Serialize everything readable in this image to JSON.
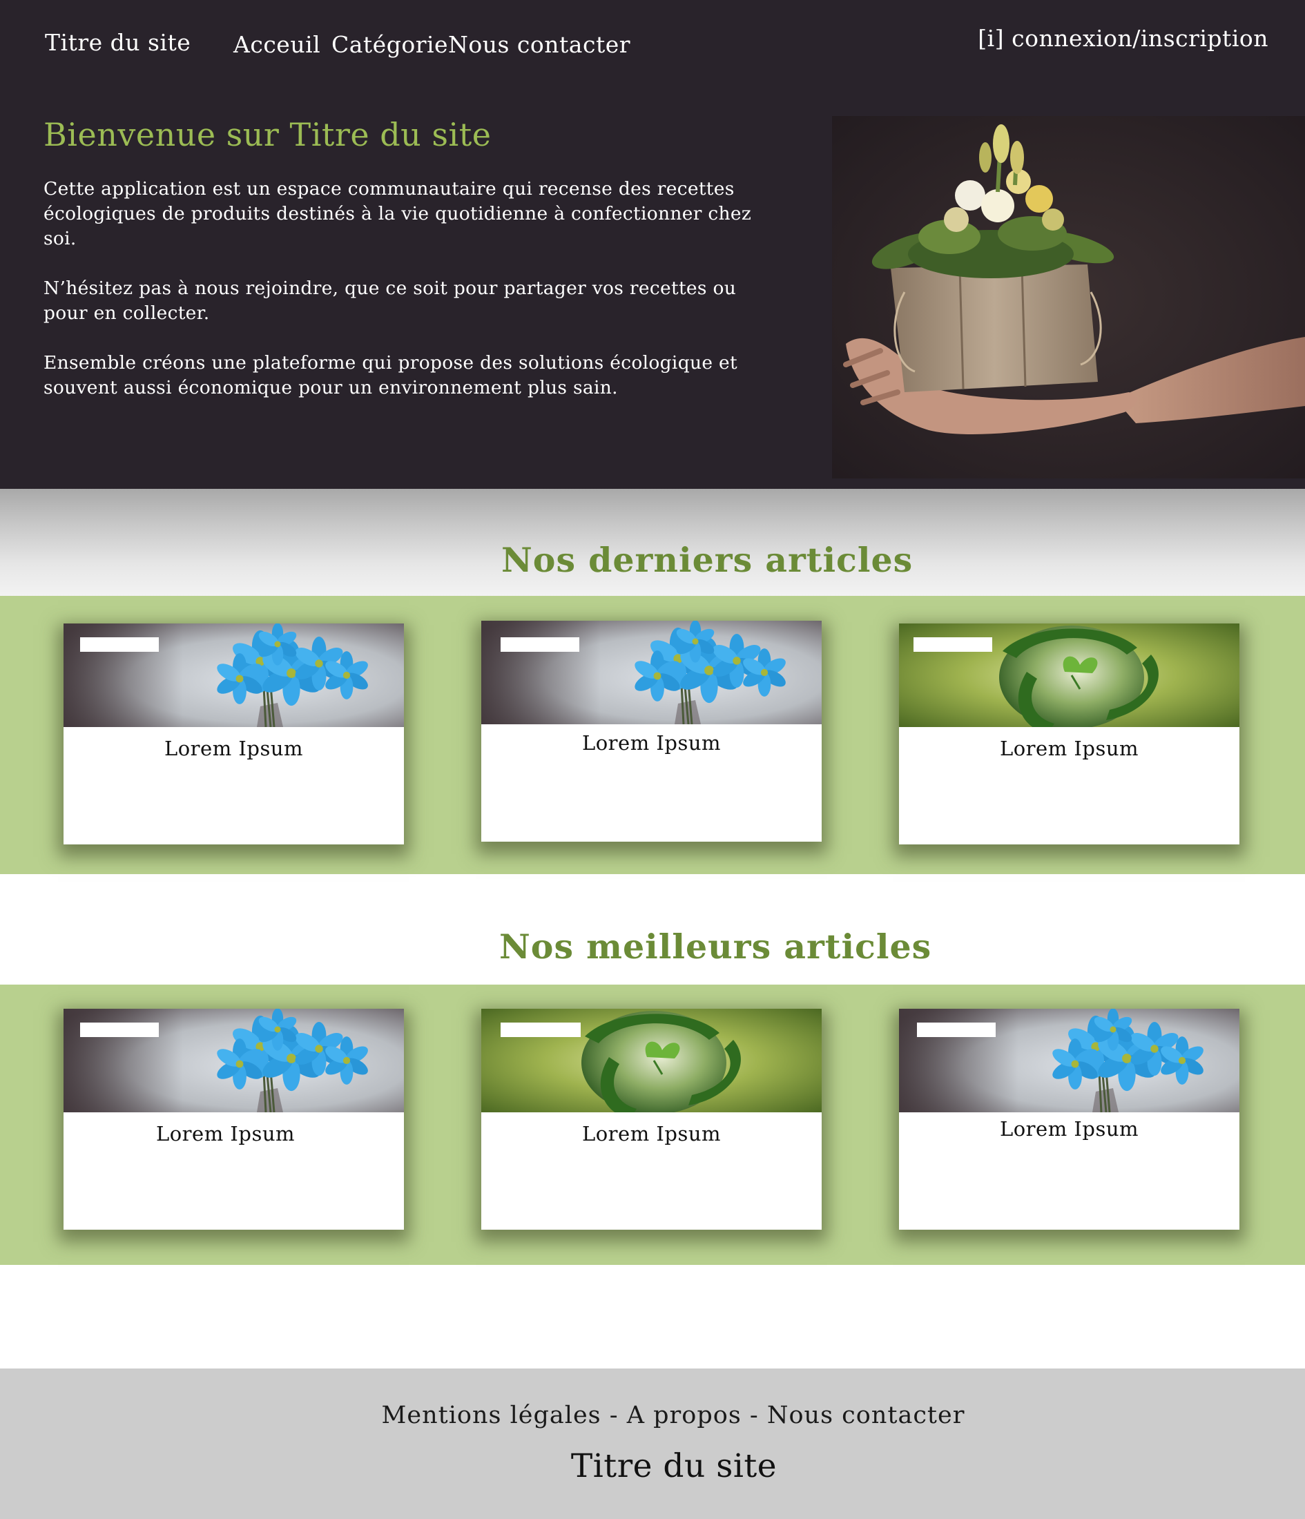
{
  "header": {
    "site_title": "Titre du site",
    "nav": [
      "Acceuil",
      "Catégorie",
      "Nous contacter"
    ],
    "login": "[i] connexion/inscription"
  },
  "hero": {
    "title": "Bienvenue sur Titre du site",
    "paragraphs": [
      "Cette application est un espace communautaire qui recense des recettes écologiques de produits destinés à la vie quotidienne à confectionner chez soi.",
      "N’hésitez pas à nous rejoindre, que ce soit pour partager vos recettes ou pour en collecter.",
      "Ensemble créons une plateforme qui propose des solutions écologique et souvent aussi économique pour un environnement plus sain."
    ],
    "image": "flowers-in-paper-bag-hands-photo"
  },
  "latest": {
    "title": "Nos derniers articles",
    "cards": [
      {
        "title": "Lorem Ipsum",
        "image": "blue-flowers-photo"
      },
      {
        "title": "Lorem Ipsum",
        "image": "blue-flowers-photo"
      },
      {
        "title": "Lorem Ipsum",
        "image": "green-earth-recycle-photo"
      }
    ]
  },
  "best": {
    "title": "Nos meilleurs articles",
    "cards": [
      {
        "title": "Lorem Ipsum",
        "image": "blue-flowers-photo"
      },
      {
        "title": "Lorem Ipsum",
        "image": "green-earth-recycle-photo"
      },
      {
        "title": "Lorem Ipsum",
        "image": "blue-flowers-photo"
      }
    ]
  },
  "footer": {
    "links": [
      "Mentions légales",
      "A propos",
      "Nous contacter"
    ],
    "separator": " - ",
    "site_title": "Titre du site"
  },
  "colors": {
    "hero_bg": "#29232b",
    "accent_green": "#9cbc54",
    "section_title_green": "#6b8b37",
    "band_green": "#b8d08e",
    "footer_bg": "#cccccc"
  }
}
